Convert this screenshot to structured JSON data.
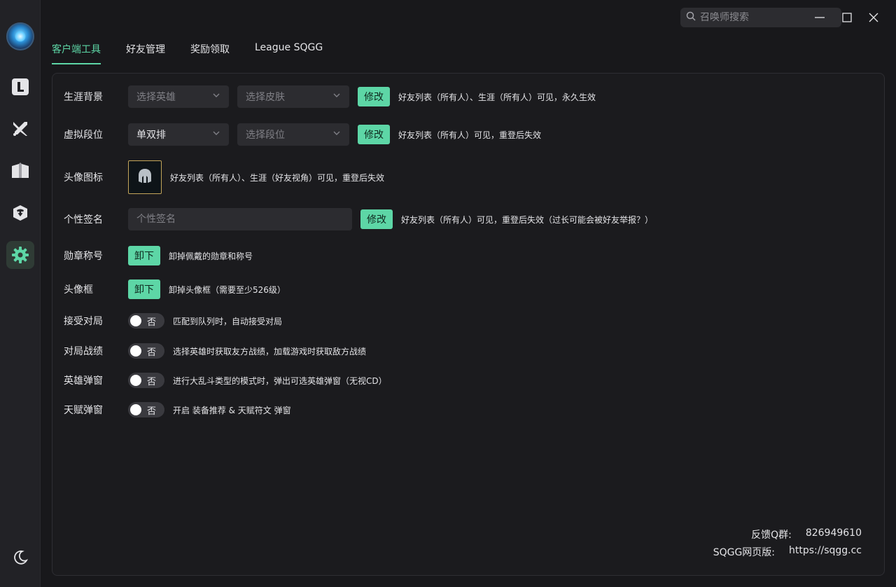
{
  "search": {
    "placeholder": "召唤师搜索"
  },
  "tabs": [
    {
      "label": "客户端工具"
    },
    {
      "label": "好友管理"
    },
    {
      "label": "奖励领取"
    },
    {
      "label": "League SQGG"
    }
  ],
  "rows": {
    "career_bg": {
      "label": "生涯背景",
      "select_champion": "选择英雄",
      "select_skin": "选择皮肤",
      "button": "修改",
      "desc": "好友列表（所有人）、生涯（所有人）可见，永久生效"
    },
    "rank": {
      "label": "虚拟段位",
      "select_queue": "单双排",
      "select_tier": "选择段位",
      "button": "修改",
      "desc": "好友列表（所有人）可见，重登后失效"
    },
    "icon": {
      "label": "头像图标",
      "desc": "好友列表（所有人）、生涯（好友视角）可见，重登后失效"
    },
    "signature": {
      "label": "个性签名",
      "placeholder": "个性签名",
      "button": "修改",
      "desc": "好友列表（所有人）可见，重登后失效（过长可能会被好友举报？）"
    },
    "badge": {
      "label": "勋章称号",
      "button": "卸下",
      "desc": "卸掉佩戴的勋章和称号"
    },
    "frame": {
      "label": "头像框",
      "button": "卸下",
      "desc": "卸掉头像框（需要至少526级）"
    },
    "auto_accept": {
      "label": "接受对局",
      "toggle": "否",
      "desc": "匹配到队列时，自动接受对局"
    },
    "match_stats": {
      "label": "对局战绩",
      "toggle": "否",
      "desc": "选择英雄时获取友方战绩，加载游戏时获取敌方战绩"
    },
    "champ_popup": {
      "label": "英雄弹窗",
      "toggle": "否",
      "desc": "进行大乱斗类型的模式时，弹出可选英雄弹窗（无视CD）"
    },
    "rune_popup": {
      "label": "天赋弹窗",
      "toggle": "否",
      "desc": "开启 装备推荐 & 天赋符文 弹窗"
    }
  },
  "footer": {
    "feedback_label": "反馈Q群:",
    "feedback_value": "826949610",
    "web_label": "SQGG网页版:",
    "web_value": "https://sqgg.cc"
  },
  "sidebar_icons": [
    "app-logo",
    "league-l-icon",
    "crossed-swords-icon",
    "book-icon",
    "ram-icon",
    "settings-gear-icon",
    "moon-icon"
  ],
  "colors": {
    "accent": "#5dd6a6",
    "background": "#18181b",
    "panel": "#1b1b1e",
    "input": "#2c2c30"
  }
}
